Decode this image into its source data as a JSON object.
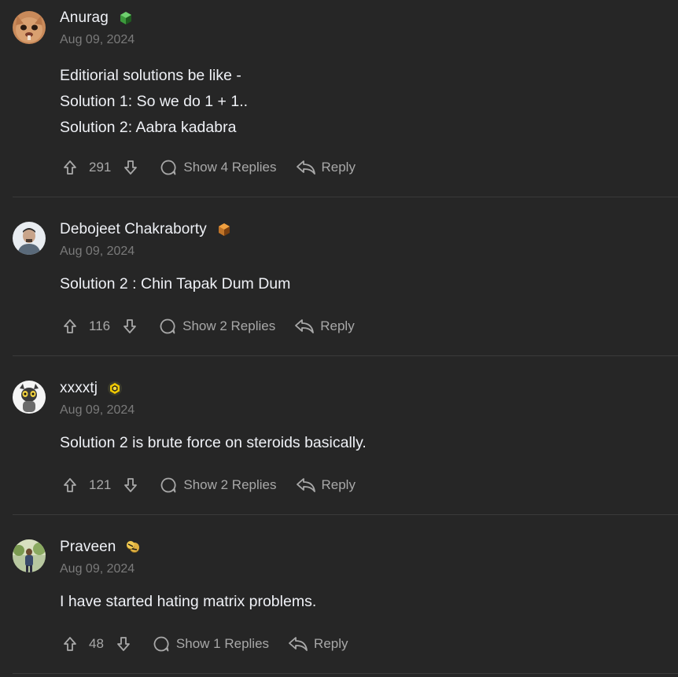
{
  "comments": [
    {
      "username": "Anurag",
      "badge": "green-cube-badge-icon",
      "date": "Aug 09, 2024",
      "body": [
        "Editiorial solutions be like -",
        "Solution 1: So we do 1 + 1..",
        "Solution 2: Aabra kadabra"
      ],
      "votes": "291",
      "replies_label": "Show 4 Replies",
      "reply_label": "Reply"
    },
    {
      "username": "Debojeet Chakraborty",
      "badge": "orange-cube-badge-icon",
      "date": "Aug 09, 2024",
      "body": [
        "Solution 2 : Chin Tapak Dum Dum"
      ],
      "votes": "116",
      "replies_label": "Show 2 Replies",
      "reply_label": "Reply"
    },
    {
      "username": "xxxxtj",
      "badge": "yellow-hex-badge-icon",
      "date": "Aug 09, 2024",
      "body": [
        "Solution 2 is brute force on steroids basically."
      ],
      "votes": "121",
      "replies_label": "Show 2 Replies",
      "reply_label": "Reply"
    },
    {
      "username": "Praveen",
      "badge": "gold-coins-badge-icon",
      "date": "Aug 09, 2024",
      "body": [
        "I have started hating matrix problems."
      ],
      "votes": "48",
      "replies_label": "Show 1 Replies",
      "reply_label": "Reply"
    }
  ],
  "colors": {
    "background": "#262626",
    "text": "#eff1f6",
    "muted": "#a8a8a8",
    "date": "#7a7a7a",
    "divider": "#3a3a3a"
  }
}
